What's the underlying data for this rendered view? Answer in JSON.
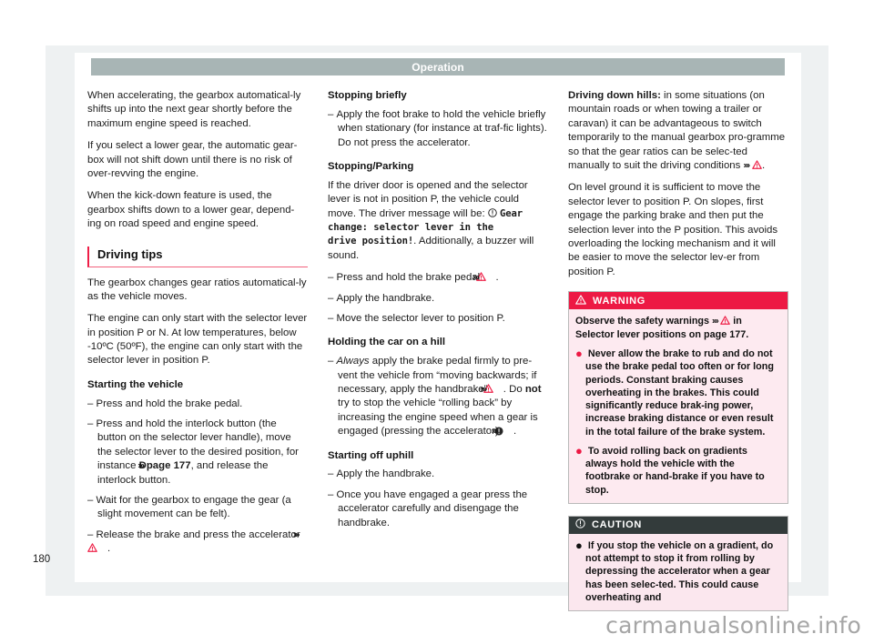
{
  "viewer": {
    "watermark": "carmanualsonline.info"
  },
  "page": {
    "header_title": "Operation",
    "folio": "180"
  },
  "icons": {
    "warning_triangle": "warning-triangle-icon",
    "chevrons": "›››",
    "info_circle": "info-circle-icon",
    "caution_circle": "caution-circle-icon"
  },
  "left_column": {
    "paragraphs": [
      "When accelerating, the gearbox automatical-ly shifts up into the next gear shortly before the maximum engine speed is reached.",
      "If you select a lower gear, the automatic gear-box will not shift down until there is no risk of over-revving the engine.",
      "When the kick-down feature is used, the gearbox shifts down to a lower gear, depend-ing on road speed and engine speed."
    ],
    "section_title": "Driving tips",
    "after_section_paragraphs": [
      "The gearbox changes gear ratios automatical-ly as the vehicle moves.",
      "The engine can only start with the selector lever in position P or N. At low temperatures, below -10ºC (50ºF), the engine can only start with the selector lever in position P."
    ],
    "subhead_starting_vehicle": "Starting the vehicle",
    "items": {
      "item1": "Press and hold the brake pedal.",
      "item2_a": "Press and hold the interlock button (the button on the selector lever handle), move the selector lever to the desired position, for instance ",
      "item2_b": "D",
      "item2_c": "page 177",
      "item2_d": ", and release the interlock button.",
      "item3": "Wait for the gearbox to engage the gear (a slight movement can be felt).",
      "item4_a": "Release the brake and press the accelerator "
    }
  },
  "middle_column": {
    "subhead_stopping_briefly": "Stopping briefly",
    "stopping_briefly_item": "Apply the foot brake to hold the vehicle briefly when stationary (for instance at traf-fic lights). Do not press the accelerator.",
    "subhead_stopping_parking": "Stopping/Parking",
    "parking_text_a": "If the driver door is opened and the selector lever is not in position P, the vehicle could move. The driver message will be: ",
    "parking_mono_1": "Gear",
    "parking_mono_2": "change: selector lever in the",
    "parking_mono_3": "drive position!",
    "parking_text_b": ". Additionally, a buzzer will sound.",
    "parking_items": {
      "item1_a": "Press and hold the brake pedal ",
      "item2": "Apply the handbrake.",
      "item3": "Move the selector lever to position P."
    },
    "subhead_holding_hill": "Holding the car on a hill",
    "hill_item_a": "Always",
    "hill_item_b": " apply the brake pedal firmly to pre-vent the vehicle from “moving backwards; if necessary, apply the handbrake” ",
    "hill_item_c": ". Do ",
    "hill_item_d": "not",
    "hill_item_e": " try to stop the vehicle “rolling back” by increasing the engine speed when a gear is engaged (pressing the accelerator) ",
    "subhead_starting_uphill": "Starting off uphill",
    "uphill_item1": "Apply the handbrake.",
    "uphill_item2": "Once you have engaged a gear press the accelerator carefully and disengage the handbrake."
  },
  "right_column": {
    "driving_down_hills_label": "Driving down hills:",
    "driving_down_hills_text": " in some situations (on mountain roads or when towing a trailer or caravan) it can be advantageous to switch temporarily to the manual gearbox pro-gramme so that the gear ratios can be selec-ted manually to suit the driving conditions ",
    "level_ground_text": "On level ground it is sufficient to move the selector lever to position P. On slopes, first engage the parking brake and then put the selection lever into the P position. This avoids overloading the locking mechanism and it will be easier to move the selector lev-er from position P.",
    "warning_box": {
      "title": "WARNING",
      "lead_a": "Observe the safety warnings ",
      "lead_b": " in Selector lever positions on page 177.",
      "bullets": [
        "Never allow the brake to rub and do not use the brake pedal too often or for long periods. Constant braking causes overheating in the brakes. This could significantly reduce brak-ing power, increase braking distance or even result in the total failure of the brake system.",
        "To avoid rolling back on gradients always hold the vehicle with the footbrake or hand-brake if you have to stop."
      ]
    },
    "caution_box": {
      "title": "CAUTION",
      "bullets": [
        "If you stop the vehicle on a gradient, do not attempt to stop it from rolling by depressing the accelerator when a gear has been selec-ted. This could cause overheating and"
      ]
    }
  }
}
